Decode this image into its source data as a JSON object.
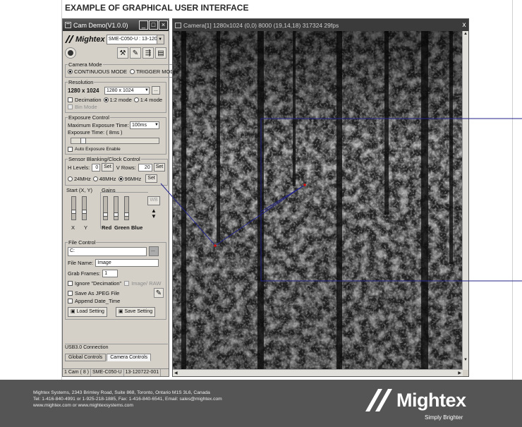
{
  "document": {
    "heading": "EXAMPLE OF GRAPHICAL USER INTERFACE"
  },
  "control_window": {
    "title": "Cam Demo(V1.0.0)",
    "brand": "Mightex",
    "model_select": "SME-C050-U : 13-120722",
    "camera_mode": {
      "legend": "Camera Mode",
      "continuous": "CONTINUOUS MODE",
      "trigger": "TRIGGER MODE",
      "selected": "continuous"
    },
    "resolution": {
      "legend": "Resolution",
      "current": "1280 x 1024",
      "select": "1280 x 1024",
      "browse": "...",
      "decimation": "Decimation",
      "mode_1_2": "1:2 mode",
      "mode_1_4": "1:4 mode",
      "bin_mode": "Bin Mode"
    },
    "exposure": {
      "legend": "Exposure Control",
      "max_label": "Maximum  Exposure Time:",
      "max_value": "100ms",
      "time_label": "Exposure Time: ( 8ms )",
      "auto": "Auto Exposure Enable",
      "slider_fraction": 0.08
    },
    "blanking": {
      "legend": "Sensor Blanking/Clock Control",
      "h_levels_label": "H Levels:",
      "h_levels_value": "0",
      "set": "Set",
      "v_rows_label": "V Rows:",
      "v_rows_value": "20",
      "clk_24": "24MHz",
      "clk_48": "48MHz",
      "clk_96": "96MHz",
      "selected_clock": "96MHz"
    },
    "start_label": "Start (X, Y)",
    "gains_label": "Gains",
    "wb": "WB",
    "x_label": "X",
    "y_label": "Y",
    "red": "Red",
    "green": "Green",
    "blue": "Blue",
    "file_control": {
      "legend": "File Control",
      "path": "C:",
      "browse": "...",
      "file_name_label": "File Name:",
      "file_name": "Image",
      "grab_frames_label": "Grab Frames:",
      "grab_frames": "1",
      "ignore_decimation": "Ignore \"Decimation\"",
      "image_raw": "Image/ RAW",
      "save_jpeg": "Save As JPEG File",
      "append_date": "Append Date_Time",
      "load_setting": "Load Setting",
      "save_setting": "Save Setting"
    },
    "connection": "USB3.0 Connection",
    "tabs": [
      "Global Controls",
      "Camera Controls"
    ],
    "active_tab": 1,
    "statusbar": [
      "1 Cam ( 8 )",
      "SME-C050-U",
      "13-120722-001"
    ]
  },
  "camera_window": {
    "title": "Camera[1]  1280x1024 (0,0) 8000 (19,14,18) 317324 29fps",
    "close": "x"
  },
  "footer": {
    "address": "Mightex Systems, 2343 Brimley Road, Suite 868, Toronto, Ontario M1S 3L6, Canada",
    "phones": "Tel: 1-416-840-4991 or 1-925-218-1885, Fax: 1-416-840-6541, Email: sales@mightex.com",
    "web": "www.mightex.com or www.mightexsystems.com",
    "brand": "Mightex",
    "tagline": "Simply Brighter"
  },
  "colors": {
    "callout": "#23238a",
    "callout_point": "#d01010",
    "footer_bg": "#555555"
  }
}
